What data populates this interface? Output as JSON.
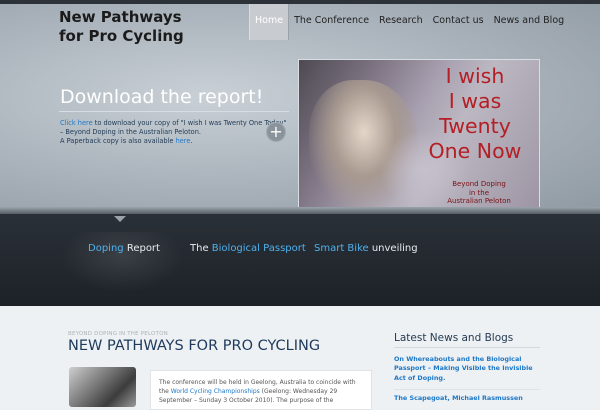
{
  "header": {
    "logo_line1": "New Pathways",
    "logo_line2": "for Pro Cycling",
    "nav": [
      "Home",
      "The Conference",
      "Research",
      "Contact us",
      "News and Blog"
    ],
    "active_nav": "Home"
  },
  "hero": {
    "title": "Download the report!",
    "text_link": "Click here",
    "text_line1_rest": " to download your copy of \"I wish I was Twenty One Today\"",
    "text_line2": "– Beyond Doping in the Australian Peloton.",
    "text_line3_pre": "A Paperback copy is also available ",
    "text_line3_link": "here",
    "text_line3_post": ".",
    "plus_icon": "+",
    "poster_lines": [
      "I wish",
      "I was",
      "Twenty",
      "One Now"
    ],
    "poster_sub_lines": [
      "Beyond Doping",
      "in the",
      "Australian Peloton"
    ]
  },
  "features": {
    "f1_hl": "Doping",
    "f1_rest": " Report",
    "f2_pre": "The ",
    "f2_hl": "Biological Passport",
    "f3_hl": "Smart Bike",
    "f3_rest": " unveiling"
  },
  "content": {
    "breadcrumb": "BEYOND DOPING IN THE PELOTON",
    "title": "NEW PATHWAYS FOR PRO CYCLING",
    "body_pre": "The conference will be held in Geelong, Australia to coincide with the ",
    "body_link": "World Cycling Championships",
    "body_post": " (Geelong: Wednesday 29 September – Sunday 3 October 2010). The purpose of the"
  },
  "sidebar": {
    "title": "Latest News and Blogs",
    "items": [
      "On Whereabouts and the Biological Passport – Making Visible the Invisible Act of Doping.",
      "The Scapegoat, Michael Rasmussen"
    ]
  },
  "colors": {
    "accent_blue": "#4fb1ee",
    "link_blue": "#1d78c8",
    "poster_red": "#b51e24"
  }
}
